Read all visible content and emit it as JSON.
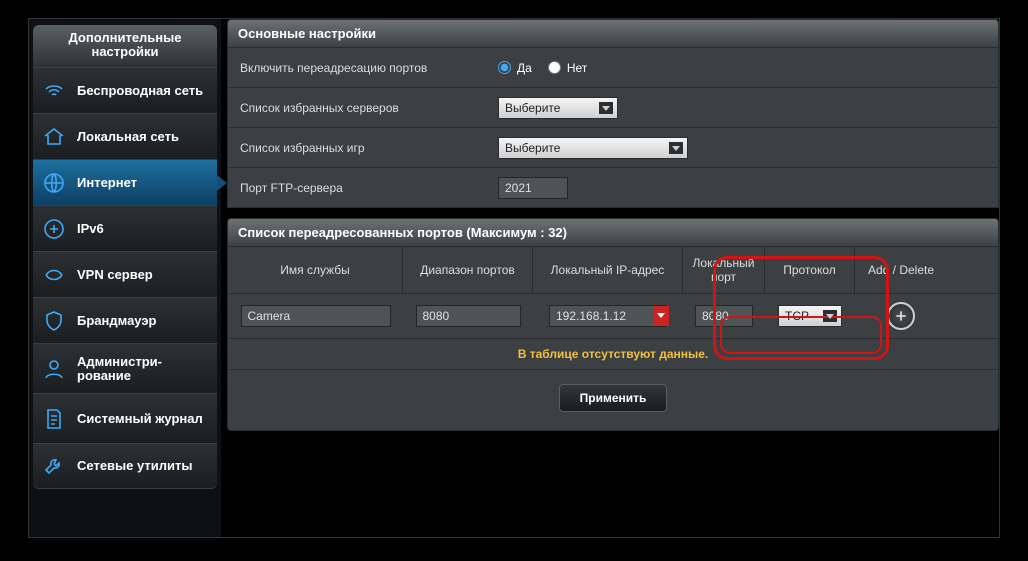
{
  "sidebar": {
    "title": "Дополнительные настройки",
    "items": [
      {
        "label": "Беспроводная сеть"
      },
      {
        "label": "Локальная сеть"
      },
      {
        "label": "Интернет"
      },
      {
        "label": "IPv6"
      },
      {
        "label": "VPN сервер"
      },
      {
        "label": "Брандмауэр"
      },
      {
        "label": "Администри-\nрование"
      },
      {
        "label": "Системный журнал"
      },
      {
        "label": "Сетевые утилиты"
      }
    ]
  },
  "sections": {
    "basic_title": "Основные настройки",
    "enable_fwd_label": "Включить переадресацию портов",
    "opt_yes": "Да",
    "opt_no": "Нет",
    "fav_servers_label": "Список избранных серверов",
    "fav_servers_value": "Выберите",
    "fav_games_label": "Список избранных игр",
    "fav_games_value": "Выберите",
    "ftp_port_label": "Порт FTP-сервера",
    "ftp_port_value": "2021",
    "port_list_title": "Список переадресованных портов (Максимум : 32)"
  },
  "port_table": {
    "headers": {
      "service": "Имя службы",
      "range": "Диапазон портов",
      "local_ip": "Локальный IP-адрес",
      "local_port": "Локальный порт",
      "proto": "Протокол",
      "add_delete": "Add / Delete"
    },
    "row": {
      "service": "Camera",
      "range": "8080",
      "local_ip": "192.168.1.12",
      "local_port": "8080",
      "proto": "TCP"
    },
    "empty_msg": "В таблице отсутствуют данные."
  },
  "apply_label": "Применить"
}
